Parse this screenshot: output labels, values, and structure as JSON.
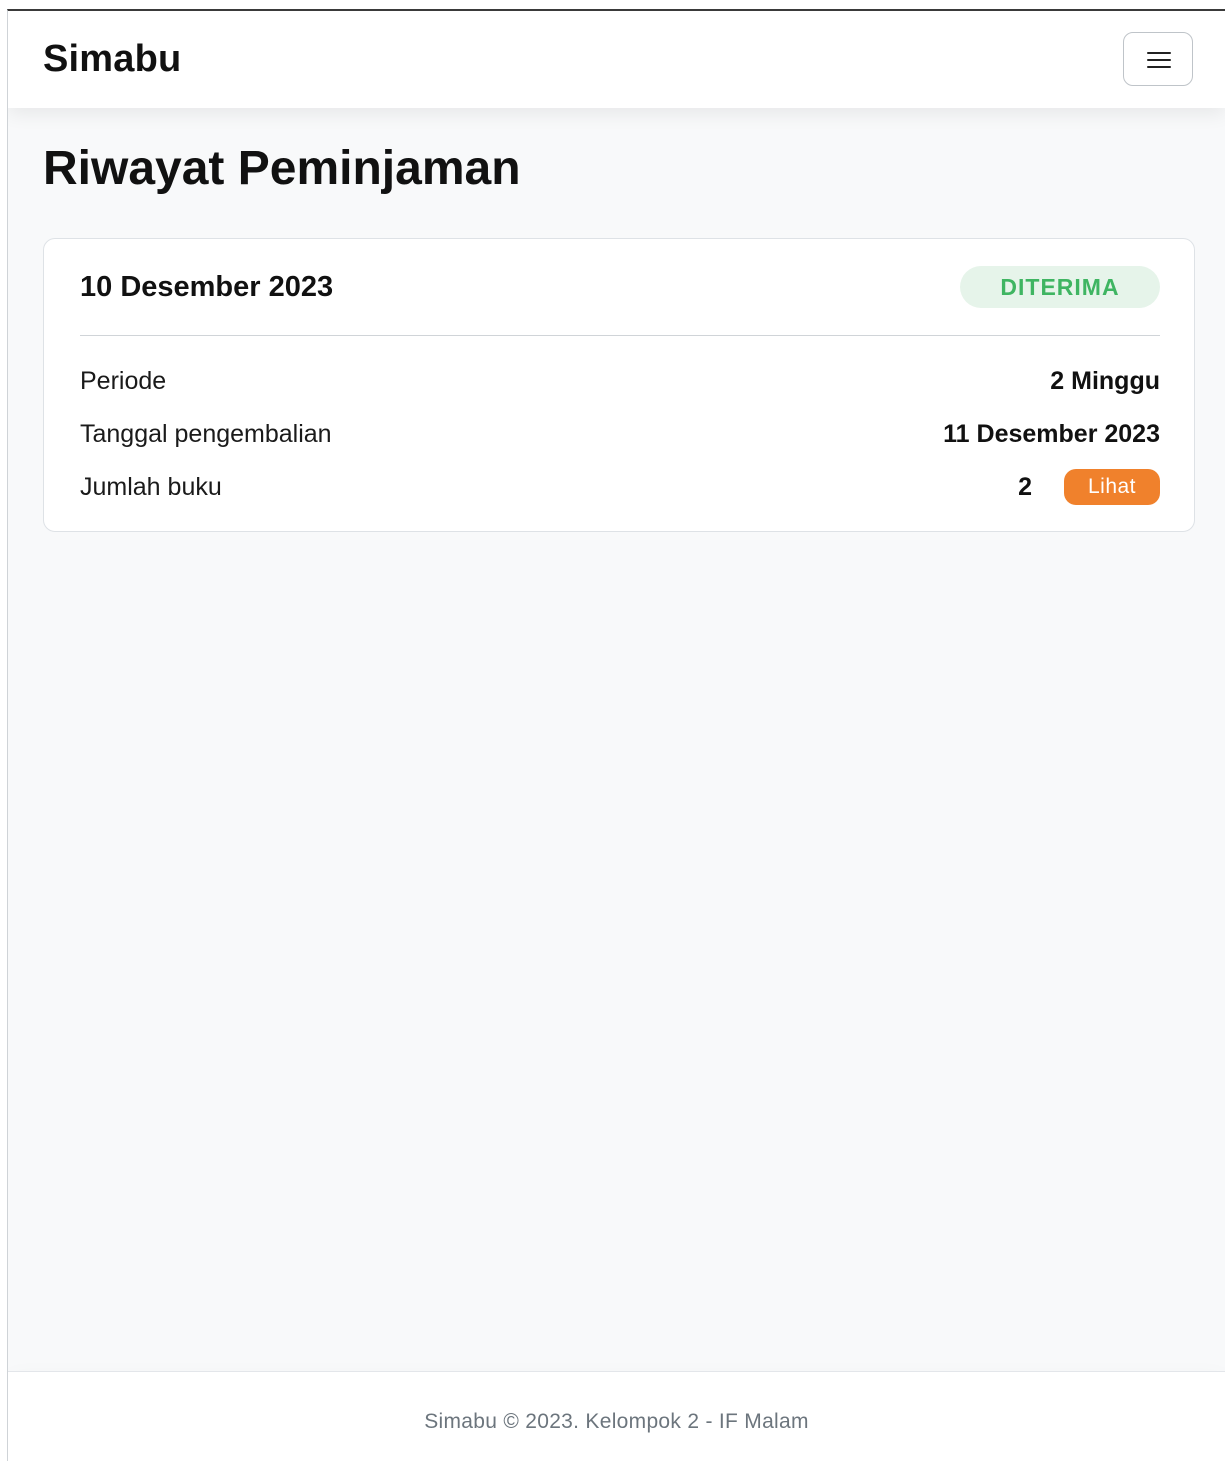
{
  "navbar": {
    "brand": "Simabu",
    "menu_icon": "hamburger-menu-icon"
  },
  "page": {
    "title": "Riwayat Peminjaman"
  },
  "loan_card": {
    "date": "10 Desember 2023",
    "status": "DITERIMA",
    "status_color": "#3fb562",
    "rows": [
      {
        "label": "Periode",
        "value": "2 Minggu"
      },
      {
        "label": "Tanggal pengembalian",
        "value": "11 Desember 2023"
      },
      {
        "label": "Jumlah buku",
        "value": "2"
      }
    ],
    "view_button_label": "Lihat",
    "view_button_color": "#f0812c"
  },
  "footer": {
    "text": "Simabu © 2023. Kelompok 2 - IF Malam"
  }
}
